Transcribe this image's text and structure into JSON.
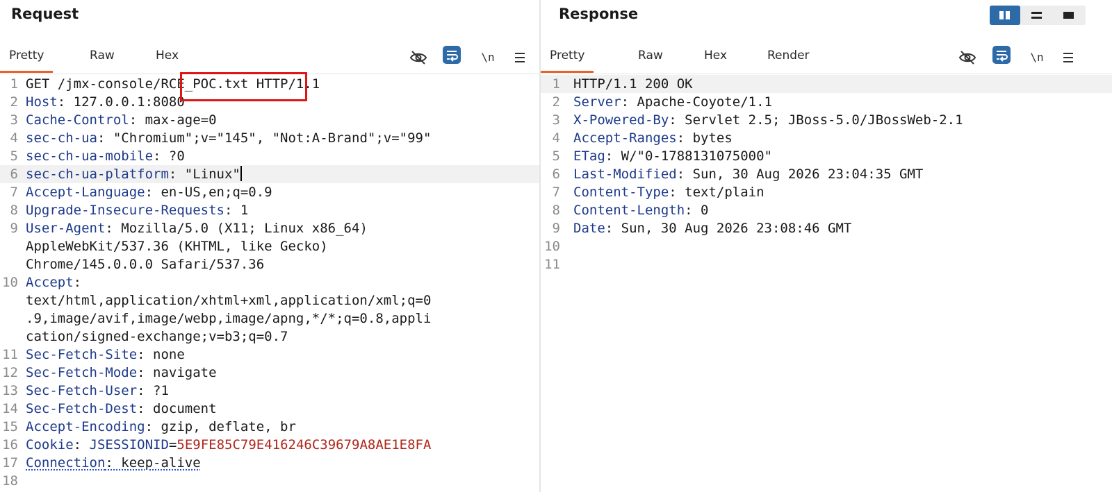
{
  "request": {
    "title": "Request",
    "tabs": [
      "Pretty",
      "Raw",
      "Hex"
    ],
    "active_tab": "Pretty",
    "newline_toggle": "\\n",
    "highlighted_path": "RCE_POC.txt",
    "lines": [
      {
        "n": "1",
        "parts": [
          {
            "t": "GET /jmx-console/RCE_POC.txt HTTP/1.1",
            "c": "t"
          }
        ]
      },
      {
        "n": "2",
        "parts": [
          {
            "t": "Host",
            "c": "k"
          },
          {
            "t": ": 127.0.0.1:8080",
            "c": "t"
          }
        ]
      },
      {
        "n": "3",
        "parts": [
          {
            "t": "Cache-Control",
            "c": "k"
          },
          {
            "t": ": max-age=0",
            "c": "t"
          }
        ]
      },
      {
        "n": "4",
        "parts": [
          {
            "t": "sec-ch-ua",
            "c": "k"
          },
          {
            "t": ": \"Chromium\";v=\"145\", \"Not:A-Brand\";v=\"99\"",
            "c": "t"
          }
        ]
      },
      {
        "n": "5",
        "parts": [
          {
            "t": "sec-ch-ua-mobile",
            "c": "k"
          },
          {
            "t": ": ?0",
            "c": "t"
          }
        ]
      },
      {
        "n": "6",
        "hl": true,
        "caret": true,
        "parts": [
          {
            "t": "sec-ch-ua-platform",
            "c": "k"
          },
          {
            "t": ": \"Linux\"",
            "c": "t"
          }
        ]
      },
      {
        "n": "7",
        "parts": [
          {
            "t": "Accept-Language",
            "c": "k"
          },
          {
            "t": ": en-US,en;q=0.9",
            "c": "t"
          }
        ]
      },
      {
        "n": "8",
        "parts": [
          {
            "t": "Upgrade-Insecure-Requests",
            "c": "k"
          },
          {
            "t": ": 1",
            "c": "t"
          }
        ]
      },
      {
        "n": "9",
        "parts": [
          {
            "t": "User-Agent",
            "c": "k"
          },
          {
            "t": ": Mozilla/5.0 (X11; Linux x86_64)",
            "c": "t"
          }
        ]
      },
      {
        "n": "",
        "parts": [
          {
            "t": "AppleWebKit/537.36 (KHTML, like Gecko)",
            "c": "t"
          }
        ]
      },
      {
        "n": "",
        "parts": [
          {
            "t": "Chrome/145.0.0.0 Safari/537.36",
            "c": "t"
          }
        ]
      },
      {
        "n": "10",
        "parts": [
          {
            "t": "Accept",
            "c": "k"
          },
          {
            "t": ":",
            "c": "t"
          }
        ]
      },
      {
        "n": "",
        "parts": [
          {
            "t": "text/html,application/xhtml+xml,application/xml;q=0",
            "c": "t"
          }
        ]
      },
      {
        "n": "",
        "parts": [
          {
            "t": ".9,image/avif,image/webp,image/apng,*/*;q=0.8,appli",
            "c": "t"
          }
        ]
      },
      {
        "n": "",
        "parts": [
          {
            "t": "cation/signed-exchange;v=b3;q=0.7",
            "c": "t"
          }
        ]
      },
      {
        "n": "11",
        "parts": [
          {
            "t": "Sec-Fetch-Site",
            "c": "k"
          },
          {
            "t": ": none",
            "c": "t"
          }
        ]
      },
      {
        "n": "12",
        "parts": [
          {
            "t": "Sec-Fetch-Mode",
            "c": "k"
          },
          {
            "t": ": navigate",
            "c": "t"
          }
        ]
      },
      {
        "n": "13",
        "parts": [
          {
            "t": "Sec-Fetch-User",
            "c": "k"
          },
          {
            "t": ": ?1",
            "c": "t"
          }
        ]
      },
      {
        "n": "14",
        "parts": [
          {
            "t": "Sec-Fetch-Dest",
            "c": "k"
          },
          {
            "t": ": document",
            "c": "t"
          }
        ]
      },
      {
        "n": "15",
        "parts": [
          {
            "t": "Accept-Encoding",
            "c": "k"
          },
          {
            "t": ": gzip, deflate, br",
            "c": "t"
          }
        ]
      },
      {
        "n": "16",
        "parts": [
          {
            "t": "Cookie",
            "c": "k"
          },
          {
            "t": ": ",
            "c": "t"
          },
          {
            "t": "JSESSIONID",
            "c": "k"
          },
          {
            "t": "=",
            "c": "t"
          },
          {
            "t": "5E9FE85C79E416246C39679A8AE1E8FA",
            "c": "cv"
          }
        ]
      },
      {
        "n": "17",
        "wavy": true,
        "parts": [
          {
            "t": "Connection",
            "c": "k"
          },
          {
            "t": ": keep-alive",
            "c": "t"
          }
        ]
      },
      {
        "n": "18",
        "parts": []
      }
    ]
  },
  "response": {
    "title": "Response",
    "tabs": [
      "Pretty",
      "Raw",
      "Hex",
      "Render"
    ],
    "active_tab": "Pretty",
    "newline_toggle": "\\n",
    "lines": [
      {
        "n": "1",
        "hl": true,
        "parts": [
          {
            "t": "HTTP/1.1 200 OK",
            "c": "t"
          }
        ]
      },
      {
        "n": "2",
        "parts": [
          {
            "t": "Server",
            "c": "k"
          },
          {
            "t": ": Apache-Coyote/1.1",
            "c": "t"
          }
        ]
      },
      {
        "n": "3",
        "parts": [
          {
            "t": "X-Powered-By",
            "c": "k"
          },
          {
            "t": ": Servlet 2.5; JBoss-5.0/JBossWeb-2.1",
            "c": "t"
          }
        ]
      },
      {
        "n": "4",
        "parts": [
          {
            "t": "Accept-Ranges",
            "c": "k"
          },
          {
            "t": ": bytes",
            "c": "t"
          }
        ]
      },
      {
        "n": "5",
        "parts": [
          {
            "t": "ETag",
            "c": "k"
          },
          {
            "t": ": W/\"0-1788131075000\"",
            "c": "t"
          }
        ]
      },
      {
        "n": "6",
        "parts": [
          {
            "t": "Last-Modified",
            "c": "k"
          },
          {
            "t": ": Sun, 30 Aug 2026 23:04:35 GMT",
            "c": "t"
          }
        ]
      },
      {
        "n": "7",
        "parts": [
          {
            "t": "Content-Type",
            "c": "k"
          },
          {
            "t": ": text/plain",
            "c": "t"
          }
        ]
      },
      {
        "n": "8",
        "parts": [
          {
            "t": "Content-Length",
            "c": "k"
          },
          {
            "t": ": 0",
            "c": "t"
          }
        ]
      },
      {
        "n": "9",
        "parts": [
          {
            "t": "Date",
            "c": "k"
          },
          {
            "t": ": Sun, 30 Aug 2026 23:08:46 GMT",
            "c": "t"
          }
        ]
      },
      {
        "n": "10",
        "parts": []
      },
      {
        "n": "11",
        "parts": []
      }
    ]
  },
  "layout_toggle": {
    "active": "side-by-side"
  },
  "colors": {
    "accent": "#2c6aa8",
    "tab_underline": "#e8622b",
    "header_key": "#1d3a8a",
    "cookie_value": "#b0261b",
    "annotation_box": "#e01414"
  }
}
